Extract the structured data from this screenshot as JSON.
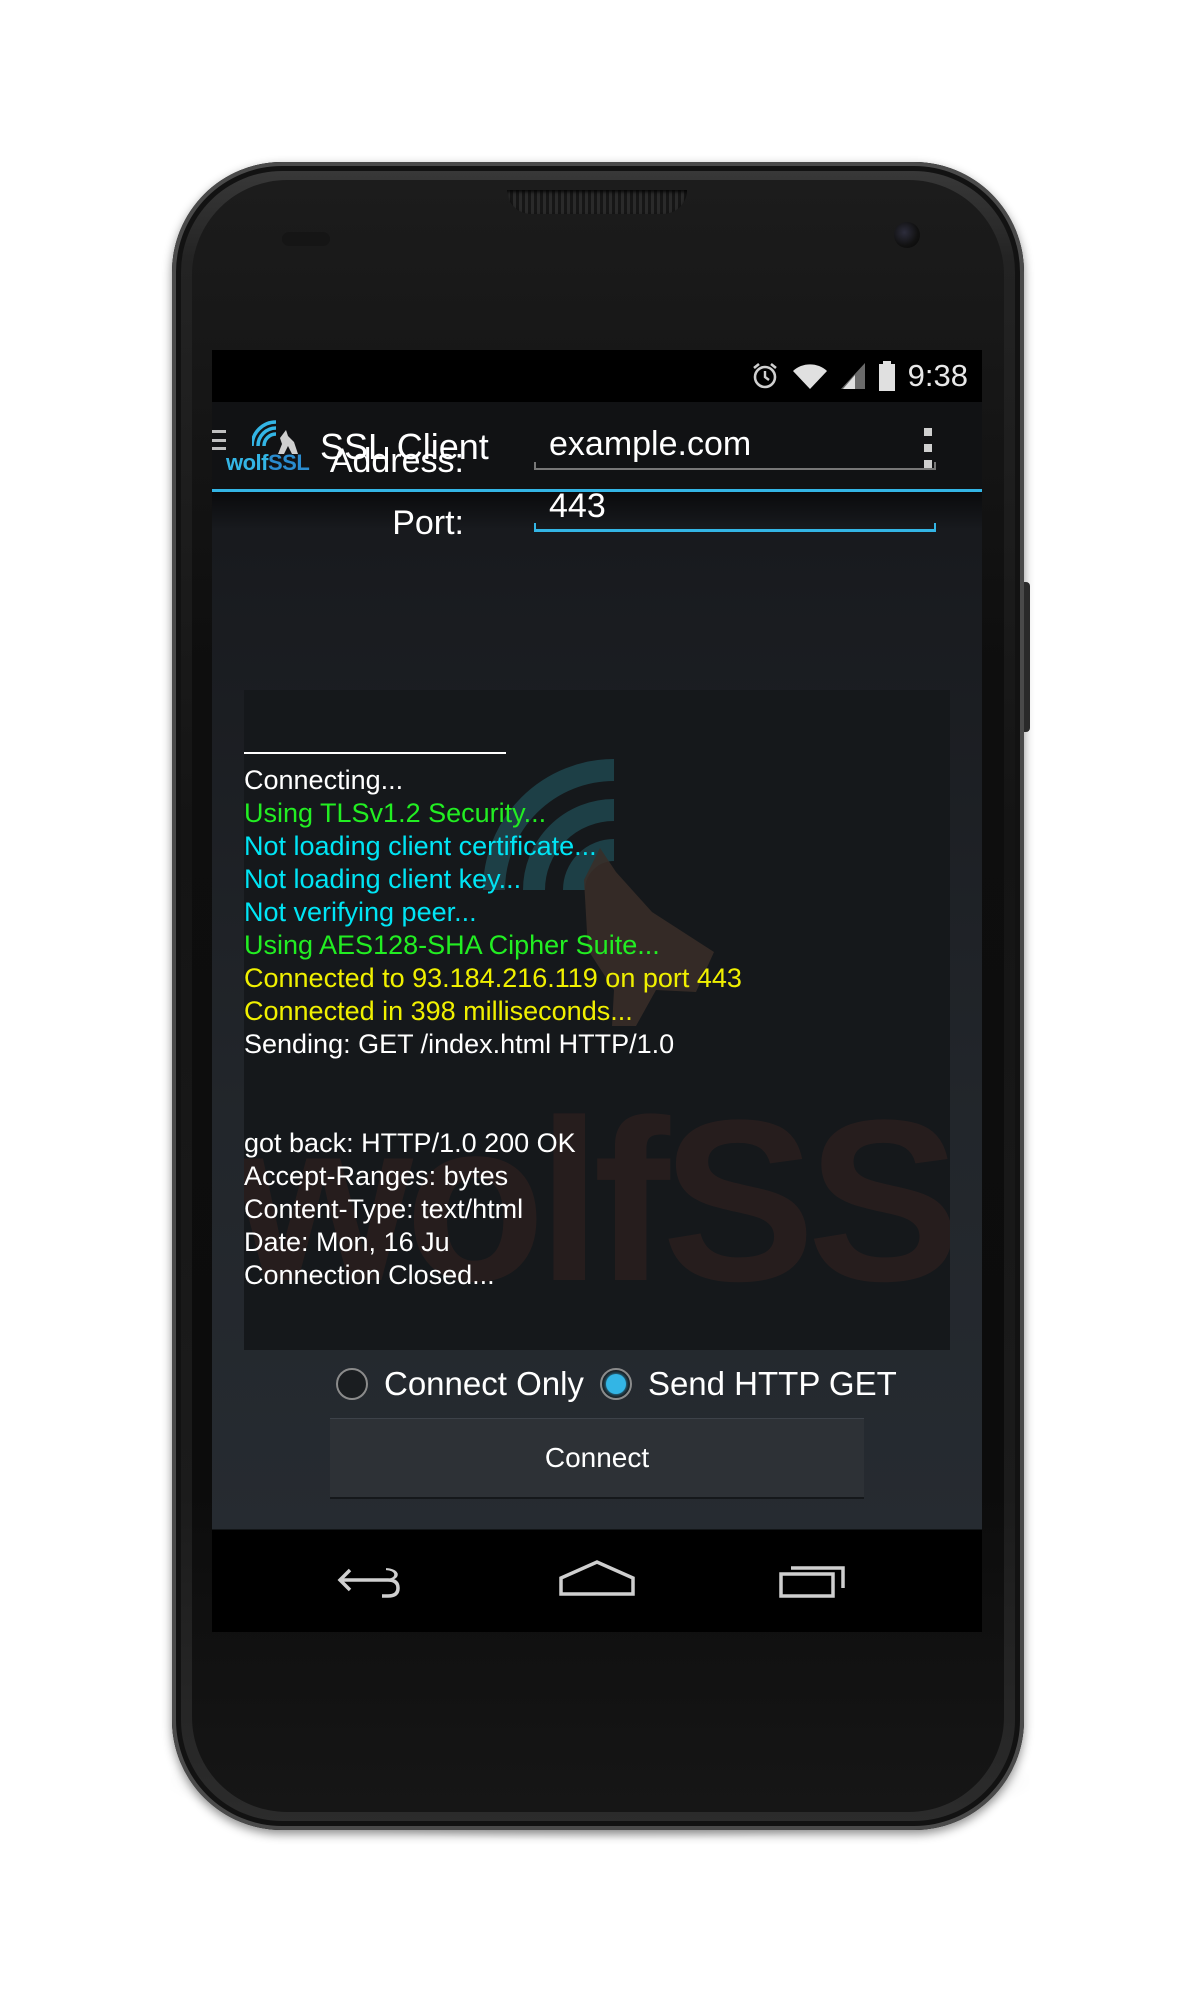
{
  "status_bar": {
    "time": "9:38"
  },
  "action_bar": {
    "logo_text_a": "wolf",
    "logo_text_b": "SSL",
    "title": "SSL Client"
  },
  "form": {
    "address_label": "Address:",
    "address_value": "example.com",
    "port_label": "Port:",
    "port_value": "443"
  },
  "console": {
    "watermark_text": "wolfSSL",
    "lines": [
      {
        "text": "Connecting...",
        "color": "white"
      },
      {
        "text": "Using TLSv1.2 Security...",
        "color": "green"
      },
      {
        "text": "Not loading client certificate...",
        "color": "cyan"
      },
      {
        "text": "Not loading client key...",
        "color": "cyan"
      },
      {
        "text": "Not verifying peer...",
        "color": "cyan"
      },
      {
        "text": "Using AES128-SHA Cipher Suite...",
        "color": "green"
      },
      {
        "text": "Connected to 93.184.216.119 on port 443",
        "color": "yellow"
      },
      {
        "text": "Connected in 398 milliseconds...",
        "color": "yellow"
      },
      {
        "text": "Sending: GET /index.html HTTP/1.0",
        "color": "white"
      },
      {
        "text": "got back: HTTP/1.0 200 OK",
        "color": "white"
      },
      {
        "text": "Accept-Ranges: bytes",
        "color": "white"
      },
      {
        "text": "Content-Type: text/html",
        "color": "white"
      },
      {
        "text": "Date: Mon, 16 Ju",
        "color": "white"
      },
      {
        "text": "Connection Closed...",
        "color": "white"
      }
    ]
  },
  "options": {
    "connect_only_label": "Connect Only",
    "send_http_get_label": "Send HTTP GET",
    "selected": "Send HTTP GET"
  },
  "connect_button": {
    "label": "Connect"
  },
  "nav_bar": {
    "icons": [
      "back-icon",
      "home-icon",
      "recent-apps-icon"
    ]
  },
  "colors": {
    "accent": "#33b5e5",
    "green": "#22ee22",
    "cyan": "#00e5f5",
    "yellow": "#f0f000"
  }
}
